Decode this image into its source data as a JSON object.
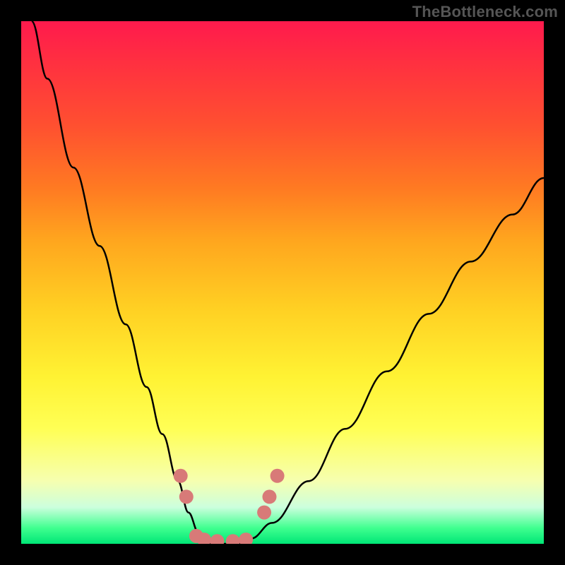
{
  "watermark": "TheBottleneck.com",
  "chart_data": {
    "type": "line",
    "title": "",
    "xlabel": "",
    "ylabel": "",
    "xlim": [
      0,
      100
    ],
    "ylim": [
      0,
      100
    ],
    "grid": false,
    "legend": false,
    "background": "rainbow-gradient (red→orange→yellow→green, top→bottom)",
    "series": [
      {
        "name": "bottleneck-curve",
        "x": [
          2,
          5,
          10,
          15,
          20,
          24,
          27,
          30,
          32,
          34,
          35,
          38,
          41,
          44,
          48,
          55,
          62,
          70,
          78,
          86,
          94,
          100
        ],
        "y": [
          100,
          89,
          72,
          57,
          42,
          30,
          21,
          12,
          6,
          2,
          0,
          0,
          0,
          1,
          4,
          12,
          22,
          33,
          44,
          54,
          63,
          70
        ]
      }
    ],
    "markers": [
      {
        "name": "left-upper-dot-1",
        "x": 30.5,
        "y": 13
      },
      {
        "name": "left-upper-dot-2",
        "x": 31.6,
        "y": 9
      },
      {
        "name": "floor-dot-1",
        "x": 33.5,
        "y": 1.5
      },
      {
        "name": "floor-dot-2",
        "x": 35.0,
        "y": 0.8
      },
      {
        "name": "floor-dot-3",
        "x": 37.5,
        "y": 0.5
      },
      {
        "name": "floor-dot-4",
        "x": 40.5,
        "y": 0.5
      },
      {
        "name": "floor-dot-5",
        "x": 43.0,
        "y": 0.8
      },
      {
        "name": "right-upper-dot-1",
        "x": 46.5,
        "y": 6
      },
      {
        "name": "right-upper-dot-2",
        "x": 47.5,
        "y": 9
      },
      {
        "name": "right-upper-dot-3",
        "x": 49.0,
        "y": 13
      }
    ],
    "marker_style": {
      "color": "#d87a78",
      "radius_px": 10
    }
  }
}
